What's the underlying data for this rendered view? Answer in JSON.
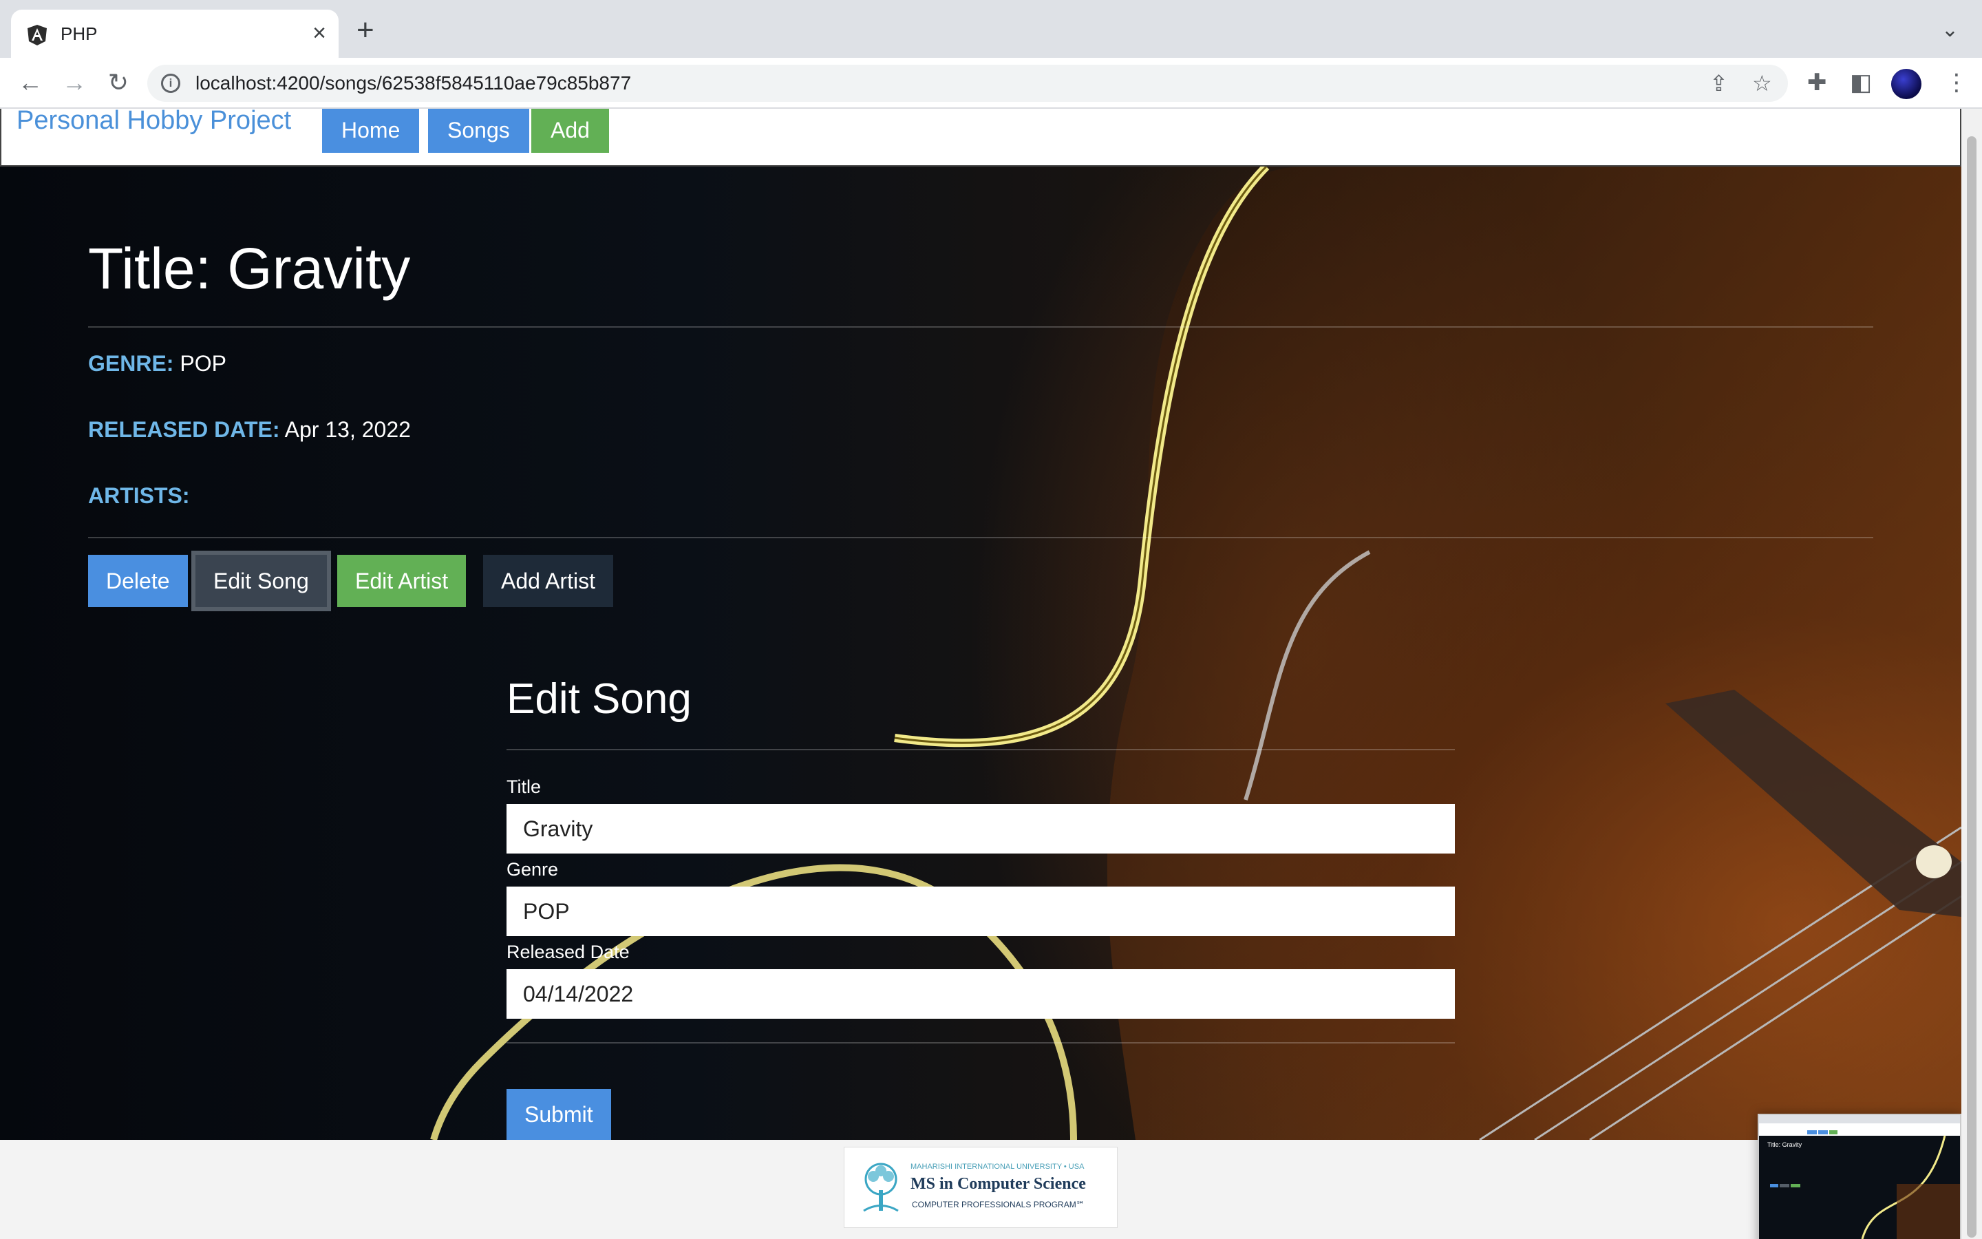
{
  "browser": {
    "tab_title": "PHP",
    "url": "localhost:4200/songs/62538f5845110ae79c85b877",
    "icons": [
      "angular-favicon-icon",
      "close-icon",
      "plus-icon",
      "chevron-down-icon",
      "back-icon",
      "forward-icon",
      "reload-icon",
      "info-icon",
      "share-icon",
      "star-icon",
      "puzzle-icon",
      "sidebar-icon",
      "profile-avatar"
    ]
  },
  "nav": {
    "brand": "Personal Hobby Project",
    "links": [
      {
        "label": "Home",
        "color": "#4a8fe0"
      },
      {
        "label": "Songs",
        "color": "#4a8fe0"
      },
      {
        "label": "Add",
        "color": "#62b055"
      }
    ]
  },
  "song": {
    "title": "Title: Gravity",
    "genre_label": "GENRE:",
    "genre": "POP",
    "released_label": "RELEASED DATE:",
    "released": "Apr 13, 2022",
    "artists_label": "ARTISTS:"
  },
  "actions": [
    {
      "label": "Delete",
      "color": "#4a8fe0"
    },
    {
      "label": "Edit Song",
      "color": "#3a4450"
    },
    {
      "label": "Edit Artist",
      "color": "#62b055"
    },
    {
      "label": "Add Artist",
      "color": "#1e2a38"
    }
  ],
  "form": {
    "heading": "Edit Song",
    "title_label": "Title",
    "title_value": "Gravity",
    "genre_label": "Genre",
    "genre_value": "POP",
    "date_label": "Released Date",
    "date_value": "04/14/2022",
    "submit_label": "Submit"
  },
  "footer": {
    "logo_top": "MAHARISHI INTERNATIONAL UNIVERSITY • USA",
    "logo_main": "MS in Computer Science",
    "logo_sub": "COMPUTER PROFESSIONALS PROGRAM℠"
  },
  "thumbnail": {
    "title": "Title: Gravity"
  }
}
